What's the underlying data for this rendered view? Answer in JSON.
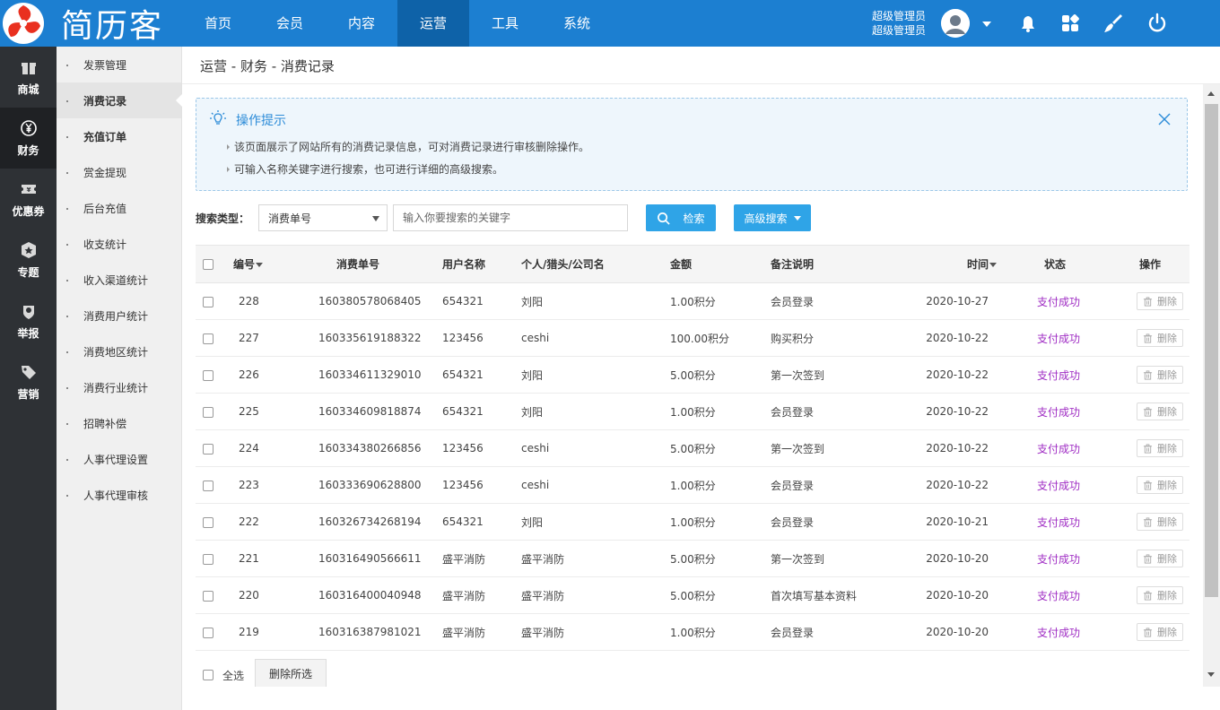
{
  "app": {
    "logo_text": "简历客",
    "brand_color": "#1c7fd1",
    "top_nav": [
      "首页",
      "会员",
      "内容",
      "运营",
      "工具",
      "系统"
    ],
    "active_nav": "运营",
    "user_line1": "超级管理员",
    "user_line2": "超级管理员"
  },
  "sidebar": {
    "items": [
      {
        "label": "商城",
        "icon": "gift-icon"
      },
      {
        "label": "财务",
        "icon": "yen-icon"
      },
      {
        "label": "优惠券",
        "icon": "coupon-icon"
      },
      {
        "label": "专题",
        "icon": "topic-icon"
      },
      {
        "label": "举报",
        "icon": "report-icon"
      },
      {
        "label": "营销",
        "icon": "tag-icon"
      }
    ],
    "active": "财务"
  },
  "submenu": {
    "items": [
      "发票管理",
      "消费记录",
      "充值订单",
      "赏金提现",
      "后台充值",
      "收支统计",
      "收入渠道统计",
      "消费用户统计",
      "消费地区统计",
      "消费行业统计",
      "招聘补偿",
      "人事代理设置",
      "人事代理审核"
    ]
  },
  "breadcrumb": "运营 - 财务 - 消费记录",
  "tips": {
    "title": "操作提示",
    "line1": "该页面展示了网站所有的消费记录信息，可对消费记录进行审核删除操作。",
    "line2": "可输入名称关键字进行搜索，也可进行详细的高级搜索。"
  },
  "search": {
    "label": "搜索类型：",
    "type_value": "消费单号",
    "placeholder": "输入你要搜索的关键字",
    "search_button": "检索",
    "advanced_button": "高级搜索"
  },
  "table": {
    "headers": {
      "id": "编号",
      "order_no": "消费单号",
      "username": "用户名称",
      "type": "个人/猎头/公司名",
      "amount": "金额",
      "remark": "备注说明",
      "time": "时间",
      "status": "状态",
      "action": "操作"
    },
    "delete_label": "删除",
    "rows": [
      {
        "id": "228",
        "order_no": "160380578068405",
        "username": "654321",
        "name": "刘阳",
        "amount": "1.00积分",
        "remark": "会员登录",
        "time": "2020-10-27",
        "status": "支付成功"
      },
      {
        "id": "227",
        "order_no": "160335619188322",
        "username": "123456",
        "name": "ceshi",
        "amount": "100.00积分",
        "remark": "购买积分",
        "time": "2020-10-22",
        "status": "支付成功"
      },
      {
        "id": "226",
        "order_no": "160334611329010",
        "username": "654321",
        "name": "刘阳",
        "amount": "5.00积分",
        "remark": "第一次签到",
        "time": "2020-10-22",
        "status": "支付成功"
      },
      {
        "id": "225",
        "order_no": "160334609818874",
        "username": "654321",
        "name": "刘阳",
        "amount": "1.00积分",
        "remark": "会员登录",
        "time": "2020-10-22",
        "status": "支付成功"
      },
      {
        "id": "224",
        "order_no": "160334380266856",
        "username": "123456",
        "name": "ceshi",
        "amount": "5.00积分",
        "remark": "第一次签到",
        "time": "2020-10-22",
        "status": "支付成功"
      },
      {
        "id": "223",
        "order_no": "160333690628800",
        "username": "123456",
        "name": "ceshi",
        "amount": "1.00积分",
        "remark": "会员登录",
        "time": "2020-10-22",
        "status": "支付成功"
      },
      {
        "id": "222",
        "order_no": "160326734268194",
        "username": "654321",
        "name": "刘阳",
        "amount": "1.00积分",
        "remark": "会员登录",
        "time": "2020-10-21",
        "status": "支付成功"
      },
      {
        "id": "221",
        "order_no": "160316490566611",
        "username": "盛平消防",
        "name": "盛平消防",
        "amount": "5.00积分",
        "remark": "第一次签到",
        "time": "2020-10-20",
        "status": "支付成功"
      },
      {
        "id": "220",
        "order_no": "160316400040948",
        "username": "盛平消防",
        "name": "盛平消防",
        "amount": "5.00积分",
        "remark": "首次填写基本资料",
        "time": "2020-10-20",
        "status": "支付成功"
      },
      {
        "id": "219",
        "order_no": "160316387981021",
        "username": "盛平消防",
        "name": "盛平消防",
        "amount": "1.00积分",
        "remark": "会员登录",
        "time": "2020-10-20",
        "status": "支付成功"
      }
    ]
  },
  "footer": {
    "select_all": "全选",
    "delete_selected": "删除所选"
  }
}
